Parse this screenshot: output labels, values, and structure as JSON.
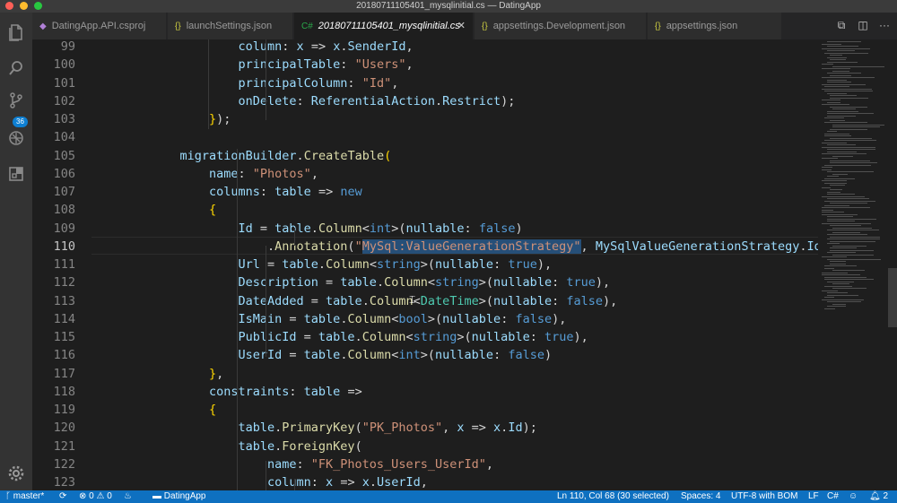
{
  "window": {
    "title": "20180711105401_mysqlinitial.cs — DatingApp"
  },
  "activity_bar": {
    "scm_badge": "36"
  },
  "tabs": [
    {
      "label": "DatingApp.API.csproj",
      "icon": "◆",
      "icon_color": "#b180d7",
      "active": false
    },
    {
      "label": "launchSettings.json",
      "icon": "{}",
      "icon_color": "#cbcb41",
      "active": false
    },
    {
      "label": "20180711105401_mysqlinitial.cs",
      "icon": "C#",
      "icon_color": "#178600",
      "active": true
    },
    {
      "label": "appsettings.Development.json",
      "icon": "{}",
      "icon_color": "#cbcb41",
      "active": false
    },
    {
      "label": "appsettings.json",
      "icon": "{}",
      "icon_color": "#cbcb41",
      "active": false
    }
  ],
  "editor": {
    "current_line": 110,
    "lines": [
      {
        "n": "99",
        "indent": 3,
        "tokens": [
          [
            "column",
            "p"
          ],
          [
            ": ",
            "o"
          ],
          [
            "x",
            "p"
          ],
          [
            " => ",
            "o"
          ],
          [
            "x",
            "p"
          ],
          [
            ".",
            "o"
          ],
          [
            "SenderId",
            "p"
          ],
          [
            ",",
            "o"
          ]
        ]
      },
      {
        "n": "100",
        "indent": 3,
        "tokens": [
          [
            "principalTable",
            "p"
          ],
          [
            ": ",
            "o"
          ],
          [
            "\"Users\"",
            "s"
          ],
          [
            ",",
            "o"
          ]
        ]
      },
      {
        "n": "101",
        "indent": 3,
        "tokens": [
          [
            "principalColumn",
            "p"
          ],
          [
            ": ",
            "o"
          ],
          [
            "\"Id\"",
            "s"
          ],
          [
            ",",
            "o"
          ]
        ]
      },
      {
        "n": "102",
        "indent": 3,
        "tokens": [
          [
            "onDelete",
            "p"
          ],
          [
            ": ",
            "o"
          ],
          [
            "ReferentialAction",
            "p"
          ],
          [
            ".",
            "o"
          ],
          [
            "Restrict",
            "p"
          ],
          [
            ");",
            "o"
          ]
        ]
      },
      {
        "n": "103",
        "indent": 2,
        "tokens": [
          [
            "}",
            "b"
          ],
          [
            ");",
            "o"
          ]
        ]
      },
      {
        "n": "104",
        "indent": 0,
        "tokens": []
      },
      {
        "n": "105",
        "indent": 1,
        "tokens": [
          [
            "migrationBuilder",
            "p"
          ],
          [
            ".",
            "o"
          ],
          [
            "CreateTable",
            "f"
          ],
          [
            "(",
            "b"
          ]
        ]
      },
      {
        "n": "106",
        "indent": 2,
        "tokens": [
          [
            "name",
            "p"
          ],
          [
            ": ",
            "o"
          ],
          [
            "\"Photos\"",
            "s"
          ],
          [
            ",",
            "o"
          ]
        ]
      },
      {
        "n": "107",
        "indent": 2,
        "tokens": [
          [
            "columns",
            "p"
          ],
          [
            ": ",
            "o"
          ],
          [
            "table",
            "p"
          ],
          [
            " => ",
            "o"
          ],
          [
            "new",
            "k"
          ]
        ]
      },
      {
        "n": "108",
        "indent": 2,
        "tokens": [
          [
            "{",
            "b"
          ]
        ]
      },
      {
        "n": "109",
        "indent": 3,
        "tokens": [
          [
            "Id",
            "p"
          ],
          [
            " = ",
            "o"
          ],
          [
            "table",
            "p"
          ],
          [
            ".",
            "o"
          ],
          [
            "Column",
            "f"
          ],
          [
            "<",
            "o"
          ],
          [
            "int",
            "k"
          ],
          [
            ">(",
            "o"
          ],
          [
            "nullable",
            "p"
          ],
          [
            ": ",
            "o"
          ],
          [
            "false",
            "k"
          ],
          [
            ")",
            "o"
          ]
        ]
      },
      {
        "n": "110",
        "indent": 4,
        "tokens": [
          [
            ".",
            "o"
          ],
          [
            "Annotation",
            "f"
          ],
          [
            "(",
            "o"
          ],
          [
            "\"",
            "s"
          ],
          [
            "MySql:ValueGenerationStrategy\"",
            "s",
            true
          ],
          [
            ", ",
            "o"
          ],
          [
            "MySqlValueGenerationStrategy",
            "p"
          ],
          [
            ".",
            "o"
          ],
          [
            "IdentityColumn",
            "p"
          ],
          [
            ");",
            "o"
          ]
        ]
      },
      {
        "n": "111",
        "indent": 3,
        "tokens": [
          [
            "Url",
            "p"
          ],
          [
            " = ",
            "o"
          ],
          [
            "table",
            "p"
          ],
          [
            ".",
            "o"
          ],
          [
            "Column",
            "f"
          ],
          [
            "<",
            "o"
          ],
          [
            "string",
            "k"
          ],
          [
            ">(",
            "o"
          ],
          [
            "nullable",
            "p"
          ],
          [
            ": ",
            "o"
          ],
          [
            "true",
            "k"
          ],
          [
            "),",
            "o"
          ]
        ]
      },
      {
        "n": "112",
        "indent": 3,
        "tokens": [
          [
            "Description",
            "p"
          ],
          [
            " = ",
            "o"
          ],
          [
            "table",
            "p"
          ],
          [
            ".",
            "o"
          ],
          [
            "Column",
            "f"
          ],
          [
            "<",
            "o"
          ],
          [
            "string",
            "k"
          ],
          [
            ">(",
            "o"
          ],
          [
            "nullable",
            "p"
          ],
          [
            ": ",
            "o"
          ],
          [
            "true",
            "k"
          ],
          [
            "),",
            "o"
          ]
        ]
      },
      {
        "n": "113",
        "indent": 3,
        "tokens": [
          [
            "DateAdded",
            "p"
          ],
          [
            " = ",
            "o"
          ],
          [
            "table",
            "p"
          ],
          [
            ".",
            "o"
          ],
          [
            "Column",
            "f"
          ],
          [
            "<",
            "o"
          ],
          [
            "DateTime",
            "t"
          ],
          [
            ">(",
            "o"
          ],
          [
            "nullable",
            "p"
          ],
          [
            ": ",
            "o"
          ],
          [
            "false",
            "k"
          ],
          [
            "),",
            "o"
          ]
        ]
      },
      {
        "n": "114",
        "indent": 3,
        "tokens": [
          [
            "IsMain",
            "p"
          ],
          [
            " = ",
            "o"
          ],
          [
            "table",
            "p"
          ],
          [
            ".",
            "o"
          ],
          [
            "Column",
            "f"
          ],
          [
            "<",
            "o"
          ],
          [
            "bool",
            "k"
          ],
          [
            ">(",
            "o"
          ],
          [
            "nullable",
            "p"
          ],
          [
            ": ",
            "o"
          ],
          [
            "false",
            "k"
          ],
          [
            "),",
            "o"
          ]
        ]
      },
      {
        "n": "115",
        "indent": 3,
        "tokens": [
          [
            "PublicId",
            "p"
          ],
          [
            " = ",
            "o"
          ],
          [
            "table",
            "p"
          ],
          [
            ".",
            "o"
          ],
          [
            "Column",
            "f"
          ],
          [
            "<",
            "o"
          ],
          [
            "string",
            "k"
          ],
          [
            ">(",
            "o"
          ],
          [
            "nullable",
            "p"
          ],
          [
            ": ",
            "o"
          ],
          [
            "true",
            "k"
          ],
          [
            "),",
            "o"
          ]
        ]
      },
      {
        "n": "116",
        "indent": 3,
        "tokens": [
          [
            "UserId",
            "p"
          ],
          [
            " = ",
            "o"
          ],
          [
            "table",
            "p"
          ],
          [
            ".",
            "o"
          ],
          [
            "Column",
            "f"
          ],
          [
            "<",
            "o"
          ],
          [
            "int",
            "k"
          ],
          [
            ">(",
            "o"
          ],
          [
            "nullable",
            "p"
          ],
          [
            ": ",
            "o"
          ],
          [
            "false",
            "k"
          ],
          [
            ")",
            "o"
          ]
        ]
      },
      {
        "n": "117",
        "indent": 2,
        "tokens": [
          [
            "}",
            "b"
          ],
          [
            ",",
            "o"
          ]
        ]
      },
      {
        "n": "118",
        "indent": 2,
        "tokens": [
          [
            "constraints",
            "p"
          ],
          [
            ": ",
            "o"
          ],
          [
            "table",
            "p"
          ],
          [
            " =>",
            "o"
          ]
        ]
      },
      {
        "n": "119",
        "indent": 2,
        "tokens": [
          [
            "{",
            "b"
          ]
        ]
      },
      {
        "n": "120",
        "indent": 3,
        "tokens": [
          [
            "table",
            "p"
          ],
          [
            ".",
            "o"
          ],
          [
            "PrimaryKey",
            "f"
          ],
          [
            "(",
            "o"
          ],
          [
            "\"PK_Photos\"",
            "s"
          ],
          [
            ", ",
            "o"
          ],
          [
            "x",
            "p"
          ],
          [
            " => ",
            "o"
          ],
          [
            "x",
            "p"
          ],
          [
            ".",
            "o"
          ],
          [
            "Id",
            "p"
          ],
          [
            ");",
            "o"
          ]
        ]
      },
      {
        "n": "121",
        "indent": 3,
        "tokens": [
          [
            "table",
            "p"
          ],
          [
            ".",
            "o"
          ],
          [
            "ForeignKey",
            "f"
          ],
          [
            "(",
            "o"
          ]
        ]
      },
      {
        "n": "122",
        "indent": 4,
        "tokens": [
          [
            "name",
            "p"
          ],
          [
            ": ",
            "o"
          ],
          [
            "\"FK_Photos_Users_UserId\"",
            "s"
          ],
          [
            ",",
            "o"
          ]
        ]
      },
      {
        "n": "123",
        "indent": 4,
        "tokens": [
          [
            "column",
            "p"
          ],
          [
            ": ",
            "o"
          ],
          [
            "x",
            "p"
          ],
          [
            " => ",
            "o"
          ],
          [
            "x",
            "p"
          ],
          [
            ".",
            "o"
          ],
          [
            "UserId",
            "p"
          ],
          [
            ",",
            "o"
          ]
        ]
      }
    ]
  },
  "status": {
    "branch": "master*",
    "errors": "0",
    "warnings": "0",
    "project": "DatingApp",
    "position": "Ln 110, Col 68 (30 selected)",
    "spaces": "Spaces: 4",
    "encoding": "UTF-8 with BOM",
    "eol": "LF",
    "language": "C#",
    "notifications": "2"
  },
  "colors": {
    "status_bar": "#0e70c0",
    "activity_bar": "#333333",
    "editor_bg": "#1e1e1e",
    "selection": "#264f78"
  }
}
